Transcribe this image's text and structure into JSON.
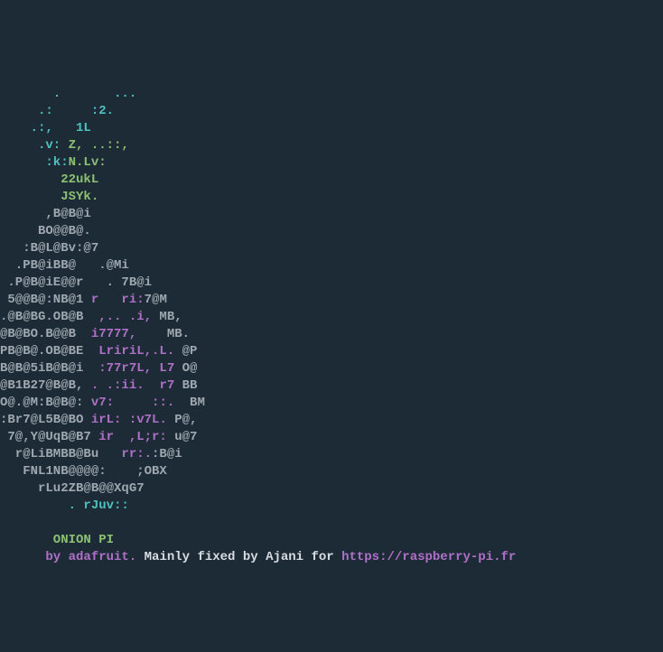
{
  "art": {
    "l01a": "       .       ...",
    "l02a": "     .:     :2.",
    "l03a": "    .:,   1L",
    "l04a": "     .v: ",
    "l04b": "Z, ..::,",
    "l05a": "      :k:",
    "l05b": "N.Lv:",
    "l06a": "        22ukL",
    "l07a": "        JSYk.",
    "l08a": "      ,B@B@i",
    "l09a": "     BO@@B@.",
    "l10a": "   :B@L@Bv:@7",
    "l11a": "  .PB@iBB@   .@Mi",
    "l12a": " .P@B@iE@@r   . 7B@i",
    "l13a": " 5@@B@:NB@1 ",
    "l13b": "r   ri:",
    "l13c": "7@M",
    "l14a": ".@B@BG.OB@B  ",
    "l14b": ",.. .i,",
    "l14c": " MB,",
    "l15a": "@B@BO.B@@B  ",
    "l15b": "i7777,",
    "l15c": "    MB.",
    "l16a": "PB@B@.OB@BE  ",
    "l16b": "LririL,.L.",
    "l16c": " @P",
    "l17a": "B@B@5iB@B@i  ",
    "l17b": ":77r7L, L7",
    "l17c": " O@",
    "l18a": "@B1B27@B@B, ",
    "l18b": ". .:ii.  r7",
    "l18c": " BB",
    "l19a": "O@.@M:B@B@: ",
    "l19b": "v7:     ::.",
    "l19c": "  BM",
    "l20a": ":Br7@L5B@BO ",
    "l20b": "irL: :v7L.",
    "l20c": " P@,",
    "l21a": " 7@,Y@UqB@B7 ",
    "l21b": "ir  ,L;r:",
    "l21c": " u@7",
    "l22a": "  r@LiBMBB@Bu   ",
    "l22b": "rr:.",
    "l22c": ":B@i",
    "l23a": "   FNL1NB@@@@:    ;OBX",
    "l24a": "     rLu2ZB@B@@XqG7",
    "l25a": "         . rJuv::",
    "title": "       ONION PI",
    "credit_a": "      by adafruit. ",
    "credit_b": "Mainly fixed by Ajani for ",
    "credit_c": "https://raspberry-pi.fr"
  }
}
